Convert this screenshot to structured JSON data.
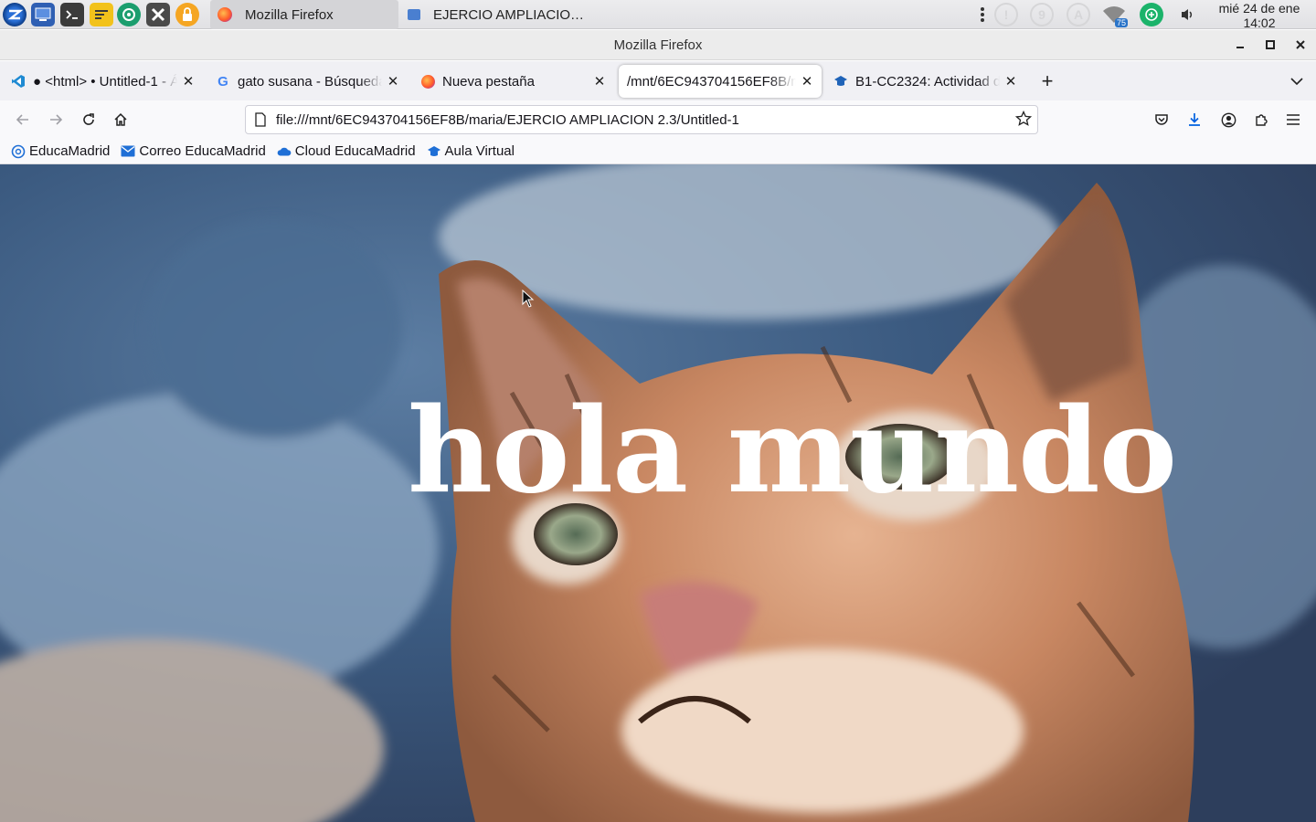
{
  "taskbar": {
    "launchers": [
      "zorin-menu-icon",
      "show-desktop-icon",
      "terminal-icon",
      "notes-icon",
      "software-icon",
      "x-app-icon",
      "lock-app-icon"
    ],
    "tasks": [
      {
        "label": "Mozilla Firefox",
        "icon": "firefox-icon",
        "active": true
      },
      {
        "label": "EJERCIO AMPLIACIO…",
        "icon": "folder-icon",
        "active": false
      }
    ],
    "tray": {
      "update_badge": "!",
      "notifications_count": "9",
      "keyboard_indicator": "A",
      "wifi_level": "75"
    },
    "clock": {
      "date": "mié 24 de ene",
      "time": "14:02"
    }
  },
  "window": {
    "title": "Mozilla Firefox"
  },
  "tabs": [
    {
      "label": "● <html> • Untitled-1 - Ár",
      "icon": "vscode-icon",
      "selected": false
    },
    {
      "label": "gato susana - Búsqueda d",
      "icon": "google-icon",
      "selected": false
    },
    {
      "label": "Nueva pestaña",
      "icon": "firefox-icon",
      "selected": false
    },
    {
      "label": "/mnt/6EC943704156EF8B/m",
      "icon": "",
      "selected": true
    },
    {
      "label": "B1-CC2324: Actividad de",
      "icon": "moodle-icon",
      "selected": false
    }
  ],
  "navbar": {
    "url": "file:///mnt/6EC943704156EF8B/maria/EJERCIO AMPLIACION 2.3/Untitled-1"
  },
  "bookmarks": [
    {
      "label": "EducaMadrid",
      "icon": "educamadrid-icon"
    },
    {
      "label": "Correo EducaMadrid",
      "icon": "mail-icon"
    },
    {
      "label": "Cloud EducaMadrid",
      "icon": "cloud-icon"
    },
    {
      "label": "Aula Virtual",
      "icon": "graduation-cap-icon"
    }
  ],
  "page": {
    "heading": "hola mundo",
    "background_image": "painted tabby cat looking up"
  },
  "colors": {
    "tab_strip": "#f0f0f4",
    "navbar": "#f9f9fb",
    "download_accent": "#0061e0",
    "heading_text": "#ffffff"
  }
}
